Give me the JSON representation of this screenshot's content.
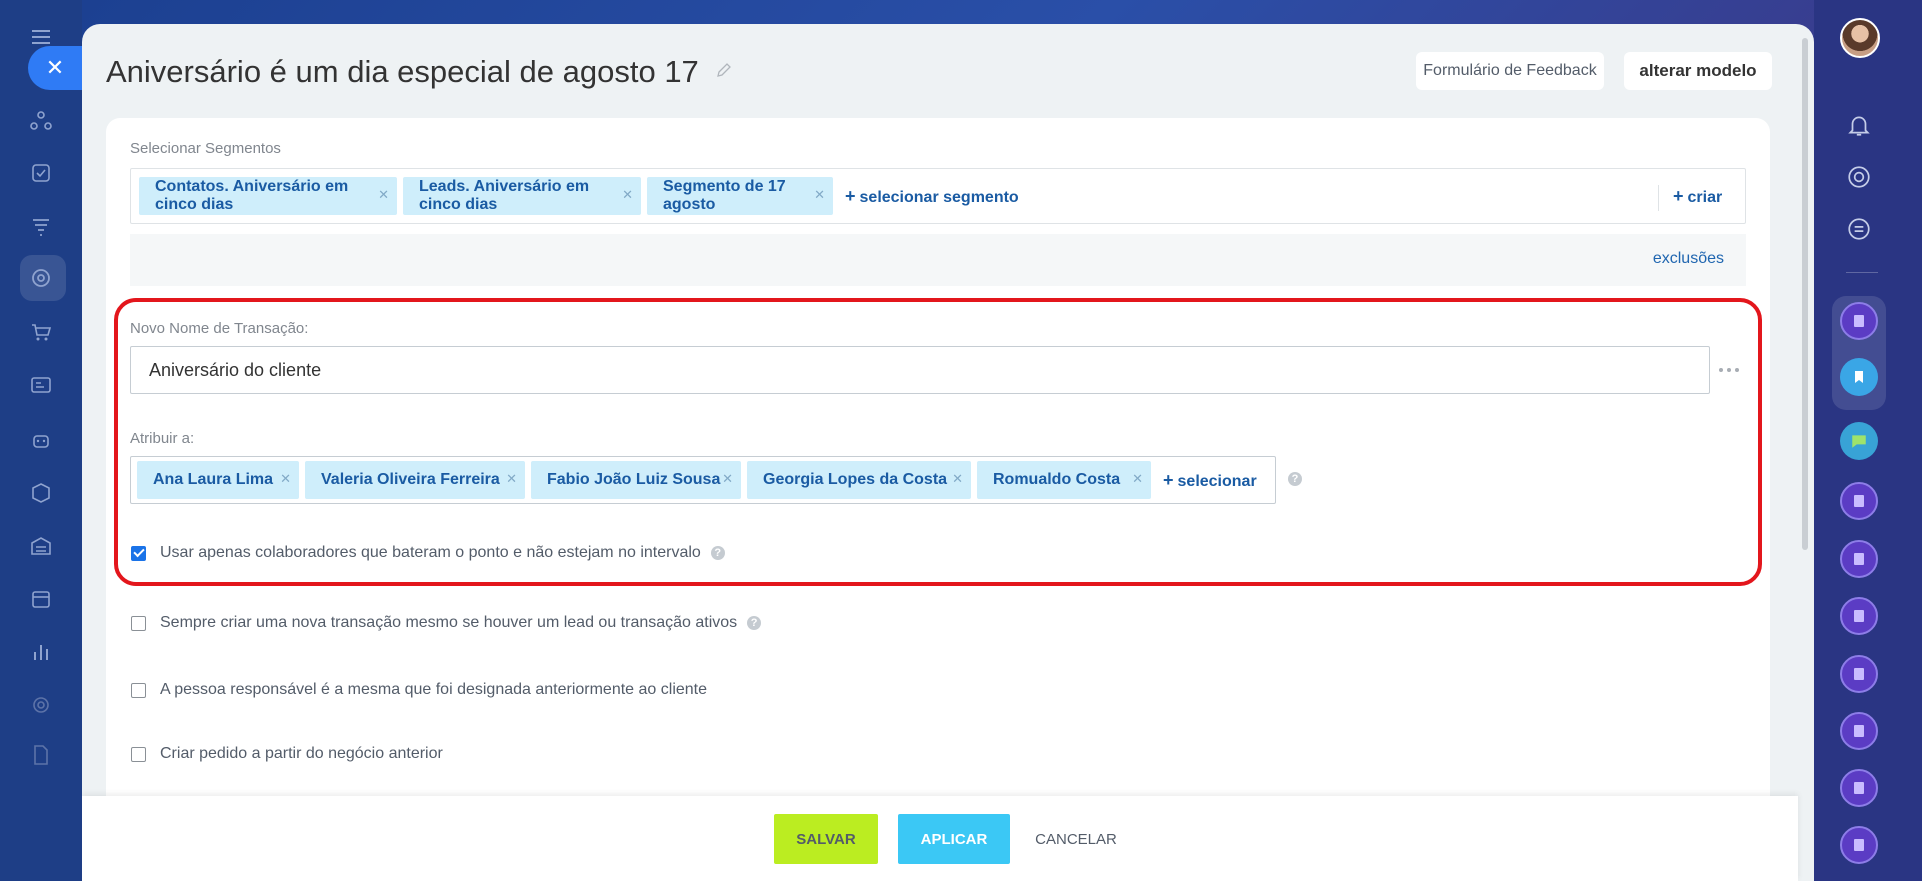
{
  "header": {
    "title": "Aniversário é um dia especial de agosto 17",
    "feedback_label": "Formulário de Feedback",
    "change_template_label": "alterar modelo"
  },
  "segments": {
    "label": "Selecionar Segmentos",
    "tags": [
      "Contatos. Aniversário em cinco dias",
      "Leads. Aniversário em cinco dias",
      "Segmento de 17 agosto"
    ],
    "select_link": "selecionar segmento",
    "create_link": "criar",
    "exclusions_link": "exclusões"
  },
  "deal": {
    "name_label": "Novo Nome de Transação:",
    "name_value": "Aniversário do cliente",
    "assign_label": "Atribuir a:",
    "assignees": [
      "Ana Laura Lima",
      "Valeria Oliveira Ferreira",
      "Fabio João Luiz Sousa",
      "Georgia Lopes da Costa",
      "Romualdo Costa"
    ],
    "assign_select_link": "selecionar"
  },
  "options": [
    {
      "label": "Usar apenas colaboradores que bateram o ponto e não estejam no intervalo",
      "checked": true,
      "help": true
    },
    {
      "label": "Sempre criar uma nova transação mesmo se houver um lead ou transação ativos",
      "checked": false,
      "help": true
    },
    {
      "label": "A pessoa responsável é a mesma que foi designada anteriormente ao cliente",
      "checked": false,
      "help": false
    },
    {
      "label": "Criar pedido a partir do negócio anterior",
      "checked": false,
      "help": false
    }
  ],
  "footer": {
    "save_label": "SALVAR",
    "apply_label": "APLICAR",
    "cancel_label": "CANCELAR"
  },
  "colors": {
    "accent": "#2f7bf5",
    "tag_bg": "#cfeefb",
    "highlight_frame": "#e3161c",
    "save": "#bbed21",
    "apply": "#3bc8f5"
  }
}
